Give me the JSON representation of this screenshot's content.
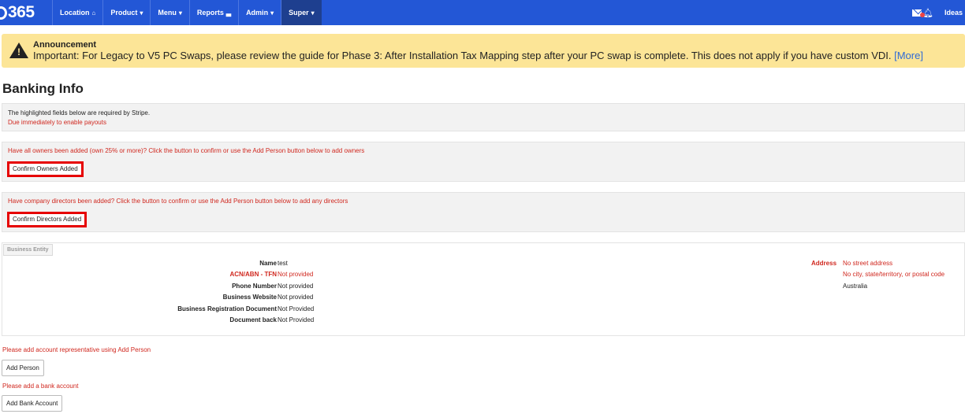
{
  "nav": {
    "logo": "365",
    "items": [
      {
        "label": "Location",
        "icon": "home-icon",
        "glyph": "⌂"
      },
      {
        "label": "Product",
        "icon": "caret-down-icon",
        "glyph": "▾"
      },
      {
        "label": "Menu",
        "icon": "caret-down-icon",
        "glyph": "▾"
      },
      {
        "label": "Reports",
        "icon": "bar-chart-icon",
        "glyph": "▃"
      },
      {
        "label": "Admin",
        "icon": "caret-down-icon",
        "glyph": "▾"
      },
      {
        "label": "Super",
        "icon": "caret-down-icon",
        "glyph": "▾"
      }
    ],
    "right_label": "Ideas",
    "colors": {
      "bar": "#2357d6",
      "active": "#1e3f8f"
    }
  },
  "announcement": {
    "title": "Announcement",
    "body": "Important: For Legacy to V5 PC Swaps, please review the guide for Phase 3: After Installation Tax Mapping step after your PC swap is complete. This does not apply if you have custom VDI.",
    "more": "[More]",
    "bg_color": "#fce597"
  },
  "page_title": "Banking Info",
  "stripe_notice": {
    "line1": "The highlighted fields below are required by Stripe.",
    "line2": "Due immediately to enable payouts"
  },
  "owners": {
    "prompt": "Have all owners been added (own 25% or more)? Click the button to confirm or use the Add Person button below to add owners",
    "button": "Confirm Owners Added"
  },
  "directors": {
    "prompt": "Have company directors been added? Click the button to confirm or use the Add Person button below to add any directors",
    "button": "Confirm Directors Added"
  },
  "business_entity": {
    "tab": "Business Entity",
    "fields": [
      {
        "label": "Name",
        "value": "test",
        "required": false
      },
      {
        "label": "ACN/ABN - TFN",
        "value": "Not provided",
        "required": true
      },
      {
        "label": "Phone Number",
        "value": "Not provided",
        "required": false
      },
      {
        "label": "Business Website",
        "value": "Not provided",
        "required": false
      },
      {
        "label": "Business Registration Document",
        "value": "Not Provided",
        "required": false
      },
      {
        "label": "Document back",
        "value": "Not Provided",
        "required": false
      }
    ],
    "address": {
      "label": "Address",
      "lines": [
        "No street address",
        "No city, state/territory, or postal code",
        "Australia"
      ]
    }
  },
  "representative_note": "Please add account representative using Add Person",
  "add_person_button": "Add Person",
  "bank_note": "Please add a bank account",
  "add_bank_button": "Add Bank Account"
}
